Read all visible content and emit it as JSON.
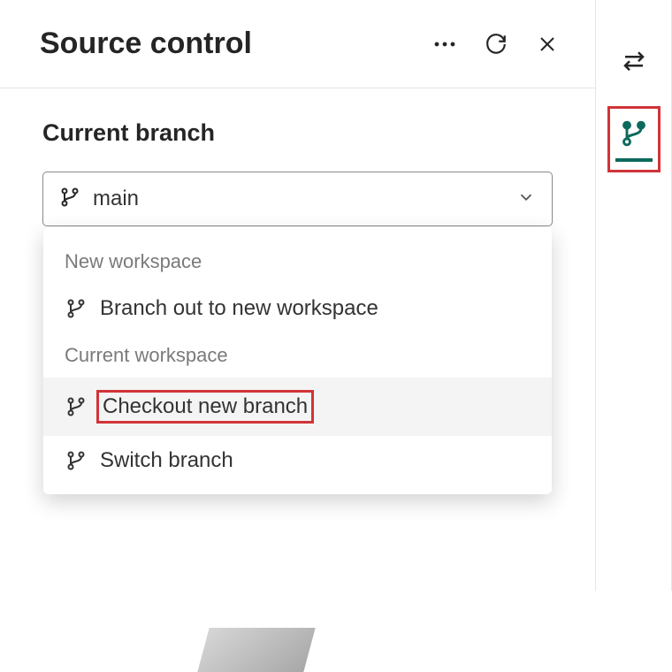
{
  "header": {
    "title": "Source control"
  },
  "branch": {
    "section_label": "Current branch",
    "current": "main"
  },
  "popup": {
    "group1_label": "New workspace",
    "item_branch_out": "Branch out to new workspace",
    "group2_label": "Current workspace",
    "item_checkout": "Checkout new branch",
    "item_switch": "Switch branch"
  }
}
